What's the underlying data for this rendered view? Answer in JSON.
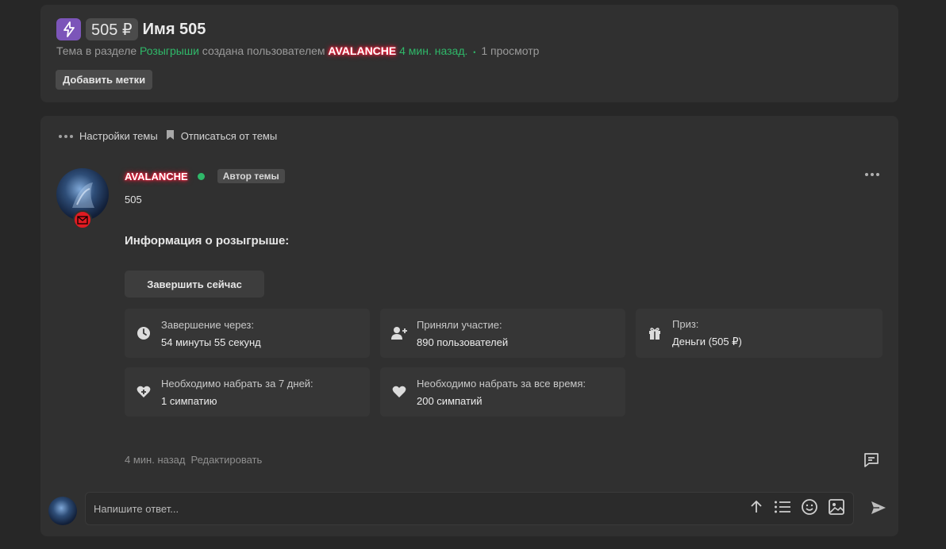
{
  "thread": {
    "price": "505 ₽",
    "title": "Имя 505",
    "meta_prefix": "Тема в разделе",
    "section": "Розыгрыши",
    "meta_created": "создана пользователем",
    "author": "AVALANCHE",
    "time_ago": "4 мин. назад.",
    "separator": "•",
    "views": "1 просмотр",
    "add_tags": "Добавить метки"
  },
  "topic_actions": {
    "settings": "Настройки темы",
    "unsubscribe": "Отписаться от темы"
  },
  "post": {
    "author": "AVALANCHE",
    "author_tag": "Автор темы",
    "body": "505",
    "giveaway_title": "Информация о розыгрыше:",
    "finish_button": "Завершить сейчас",
    "info": [
      {
        "icon": "clock-icon",
        "label": "Завершение через:",
        "value": "54 минуты 55 секунд"
      },
      {
        "icon": "user-plus-icon",
        "label": "Приняли участие:",
        "value": "890 пользователей"
      },
      {
        "icon": "gift-icon",
        "label": "Приз:",
        "value": "Деньги (505 ₽)"
      },
      {
        "icon": "heart-plus-icon",
        "label": "Необходимо набрать за 7 дней:",
        "value": "1 симпатию"
      },
      {
        "icon": "heart-icon",
        "label": "Необходимо набрать за все время:",
        "value": "200 симпатий"
      }
    ],
    "time": "4 мин. назад",
    "edit": "Редактировать"
  },
  "reply": {
    "placeholder": "Напишите ответ..."
  },
  "colors": {
    "accent_green": "#2fb869",
    "badge_purple": "#7c55b9",
    "nick_glow": "#ff1e3c",
    "mail_red": "#e01b22"
  }
}
